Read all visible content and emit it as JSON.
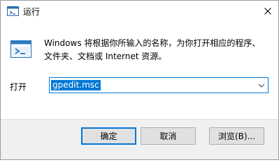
{
  "window": {
    "title": "运行"
  },
  "content": {
    "description_line1": "Windows 将根据你所输入的名称，为你打开相应的程序、",
    "description_line2": "文件夹、文档或 Internet 资源。",
    "open_label": "打开",
    "combo_value": "gpedit.msc"
  },
  "buttons": {
    "ok": "确定",
    "cancel": "取消",
    "browse": "浏览(B)..."
  },
  "icons": {
    "app": "run-app-icon",
    "large": "run-window-icon",
    "close": "close-icon",
    "dropdown": "chevron-down-icon"
  },
  "colors": {
    "accent": "#0078d7",
    "footer_bg": "#f0f0f0",
    "button_bg": "#e1e1e1"
  }
}
